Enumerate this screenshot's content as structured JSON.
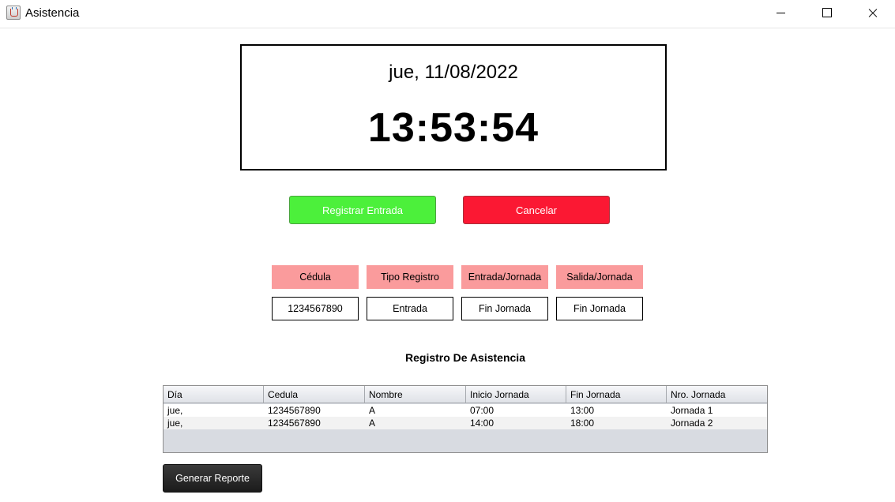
{
  "window": {
    "title": "Asistencia",
    "icon": "java-cup-icon"
  },
  "clock": {
    "date": "jue, 11/08/2022",
    "time": "13:53:54"
  },
  "actions": {
    "register_label": "Registrar Entrada",
    "cancel_label": "Cancelar"
  },
  "fields": [
    {
      "label": "Cédula",
      "value": "1234567890"
    },
    {
      "label": "Tipo Registro",
      "value": "Entrada"
    },
    {
      "label": "Entrada/Jornada",
      "value": "Fin Jornada"
    },
    {
      "label": "Salida/Jornada",
      "value": "Fin Jornada"
    }
  ],
  "attendance": {
    "title": "Registro De Asistencia",
    "columns": [
      "Día",
      "Cedula",
      "Nombre",
      "Inicio Jornada",
      "Fin Jornada",
      "Nro. Jornada"
    ],
    "rows": [
      [
        "jue,",
        "1234567890",
        "A",
        "07:00",
        "13:00",
        "Jornada 1"
      ],
      [
        "jue,",
        "1234567890",
        "A",
        "14:00",
        "18:00",
        "Jornada 2"
      ]
    ]
  },
  "report_button": "Generar Reporte",
  "colors": {
    "register_button": "#4cf03b",
    "cancel_button": "#fb1833",
    "field_header": "#fa9b9c",
    "report_button": "#2a2a2a"
  }
}
